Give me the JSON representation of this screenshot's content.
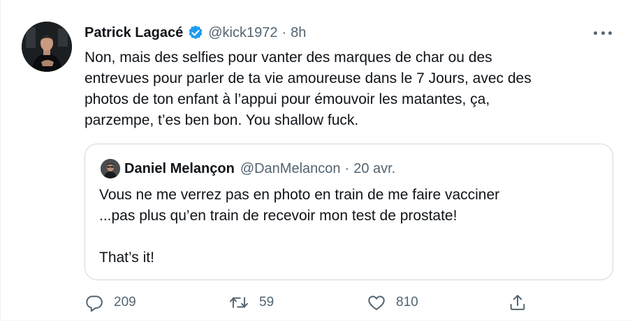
{
  "tweet": {
    "author_name": "Patrick Lagacé",
    "handle": "@kick1972",
    "separator": "·",
    "time": "8h",
    "text_lines": [
      "Non, mais des selfies pour vanter des marques de char ou des",
      "entrevues pour parler de ta vie amoureuse dans le 7 Jours, avec des",
      "photos de ton enfant à l’appui pour émouvoir les matantes, ça,",
      "parzempe, t’es ben bon. You shallow fuck."
    ]
  },
  "quoted": {
    "author_name": "Daniel Melançon",
    "handle": "@DanMelancon",
    "separator": "·",
    "date": "20 avr.",
    "text_lines": [
      "Vous ne me verrez pas en photo en train de me faire vacciner",
      "...pas plus qu’en train de recevoir mon test de prostate!",
      "",
      "That’s it!"
    ]
  },
  "actions": {
    "reply_count": "209",
    "retweet_count": "59",
    "like_count": "810"
  },
  "icons": [
    "verified-badge-icon",
    "more-options-icon",
    "reply-icon",
    "retweet-icon",
    "like-icon",
    "share-icon"
  ],
  "colors": {
    "verified_blue": "#1d9bf0",
    "secondary_text": "#536471",
    "quote_border": "#cfd9de"
  }
}
